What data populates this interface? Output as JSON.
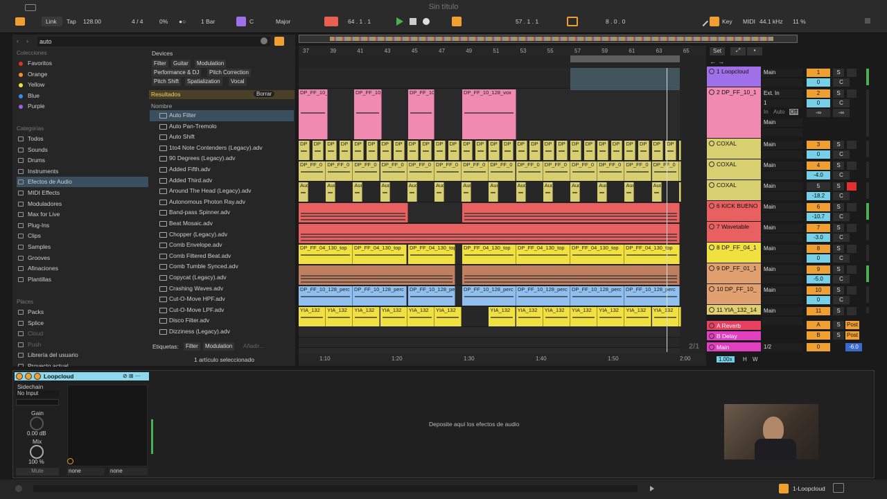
{
  "window_title": "Sin título",
  "transport": {
    "link": "Link",
    "tap": "Tap",
    "tempo": "128.00",
    "signature": "4 / 4",
    "swing": "0%",
    "quantize": "1 Bar",
    "key_root": "C",
    "key_scale": "Major",
    "position": "64 .  1 .  1",
    "loop_start": "57 .  1 .  1",
    "loop_length": "8 .  0 .  0",
    "key_label": "Key",
    "midi_label": "MIDI",
    "sample_rate": "44.1 kHz",
    "cpu": "11 %"
  },
  "browser": {
    "search": "auto",
    "collections_title": "Colecciones",
    "collections": [
      {
        "label": "Favoritos",
        "color": "#e0302c"
      },
      {
        "label": "Orange",
        "color": "#f0902c"
      },
      {
        "label": "Yellow",
        "color": "#f0e040"
      },
      {
        "label": "Blue",
        "color": "#3a8ee8"
      },
      {
        "label": "Purple",
        "color": "#a060e0"
      }
    ],
    "categories_title": "Categorías",
    "categories": [
      "Todos",
      "Sounds",
      "Drums",
      "Instruments",
      "Efectos de Audio",
      "MIDI Effects",
      "Moduladores",
      "Max for Live",
      "Plug-Ins",
      "Clips",
      "Samples",
      "Grooves",
      "Afinaciones",
      "Plantillas"
    ],
    "places_title": "Places",
    "places": [
      "Packs",
      "Splice",
      "Cloud",
      "Push",
      "Librería del usuario",
      "Proyecto actual"
    ],
    "devices_label": "Devices",
    "filter_tags": [
      "Filter",
      "Guitar",
      "Modulation",
      "Performance & DJ",
      "Pitch Correction",
      "Pitch Shift",
      "Spatialization",
      "Vocal"
    ],
    "results_label": "Resultados",
    "clear_label": "Borrar",
    "column_name": "Nombre",
    "results": [
      "Auto Filter",
      "Auto Pan-Tremolo",
      "Auto Shift",
      "1to4 Note Contenders (Legacy).adv",
      "90 Degrees (Legacy).adv",
      "Added Fifth.adv",
      "Added Third.adv",
      "Around The Head (Legacy).adv",
      "Autonomous Photon Ray.adv",
      "Band-pass Spinner.adv",
      "Beat Mosaic.adv",
      "Chopper (Legacy).adv",
      "Comb Envelope.adv",
      "Comb Filtered Beat.adv",
      "Comb Tumble Synced.adv",
      "Copycat (Legacy).adv",
      "Crashing Waves.adv",
      "Cut-O-Move HPF.adv",
      "Cut-O-Move LPF.adv",
      "Disco Filter.adv",
      "Dizziness (Legacy).adv"
    ],
    "labels_title": "Etiquetas:",
    "labels": [
      "Filter",
      "Modulation",
      "Añadir..."
    ],
    "status": "1 artículo seleccionado"
  },
  "ruler": [
    "37",
    "39",
    "41",
    "43",
    "45",
    "47",
    "49",
    "51",
    "53",
    "55",
    "57",
    "59",
    "61",
    "63",
    "65"
  ],
  "time_ruler": [
    "1:10",
    "1:20",
    "1:30",
    "1:40",
    "1:50",
    "2:00"
  ],
  "zoom_readout": "2/1",
  "set_label": "Set",
  "tracks": [
    {
      "name": "1 Loopcloud",
      "color": "#a070e8",
      "io": "Main",
      "num": "1",
      "vol": "0",
      "pan": "C"
    },
    {
      "name": "2 DP_FF_10_1",
      "color": "#f08ab0",
      "io": "Ext. In",
      "io2": "1",
      "io3": "Main",
      "num": "2",
      "vol": "0",
      "pan": "C",
      "monitor_in": "In",
      "monitor_auto": "Auto",
      "monitor_off": "Off",
      "extra1": "-∞",
      "extra2": "-∞"
    },
    {
      "name": "COXAL",
      "color": "#d8d070",
      "io": "Main",
      "num": "3",
      "vol": "0",
      "pan": "C"
    },
    {
      "name": "COXAL",
      "color": "#d8d070",
      "io": "Main",
      "num": "4",
      "vol": "-4.0",
      "pan": "C"
    },
    {
      "name": "COXAL",
      "color": "#d8d070",
      "io": "Main",
      "num": "5",
      "vol": "-18.2",
      "pan": "C"
    },
    {
      "name": "6 KICK BUENO",
      "color": "#e86060",
      "io": "Main",
      "num": "6",
      "vol": "-10.7",
      "pan": "C"
    },
    {
      "name": "7 Wavetable",
      "color": "#e86060",
      "io": "Main",
      "num": "7",
      "vol": "-3.0",
      "pan": "C"
    },
    {
      "name": "8 DP_FF_04_1",
      "color": "#f0e040",
      "io": "Main",
      "num": "8",
      "vol": "0",
      "pan": "C"
    },
    {
      "name": "9 DP_FF_01_1",
      "color": "#e0a070",
      "io": "Main",
      "num": "9",
      "vol": "-5.0",
      "pan": "C"
    },
    {
      "name": "10 DP_FF_10_",
      "color": "#e0a070",
      "io": "Main",
      "num": "10",
      "vol": "0",
      "pan": "C"
    },
    {
      "name": "11 YIA_132_14",
      "color": "#e0d070",
      "io": "Main",
      "num": "11",
      "vol": "",
      "pan": ""
    }
  ],
  "returns": [
    {
      "name": "A Reverb",
      "color": "#e84060",
      "num": "A",
      "post": "Post"
    },
    {
      "name": "B Delay",
      "color": "#e040c0",
      "num": "B",
      "post": "Post"
    }
  ],
  "main": {
    "name": "Main",
    "io": "1/2",
    "num": "0",
    "vol": "-6.0"
  },
  "zoom": "1.00x",
  "clip_labels": {
    "t2": "DP_FF_10_128_vox",
    "t3": "DP",
    "t4": "DP_FF_0",
    "t5": "Aud",
    "t8": "DP_FF_04_130_top",
    "t10": "DP_FF_10_128_perc",
    "t11": "YIA_132"
  },
  "device": {
    "title": "Loopcloud",
    "sidechain": "Sidechain",
    "sidechain_input": "No Input",
    "gain_label": "Gain",
    "gain_value": "0.00 dB",
    "mix_label": "Mix",
    "mix_value": "100 %",
    "mute": "Mute",
    "none1": "none",
    "none2": "none",
    "drop_hint": "Deposite aquí los efectos de audio"
  },
  "status_bar": {
    "track": "1-Loopcloud"
  }
}
